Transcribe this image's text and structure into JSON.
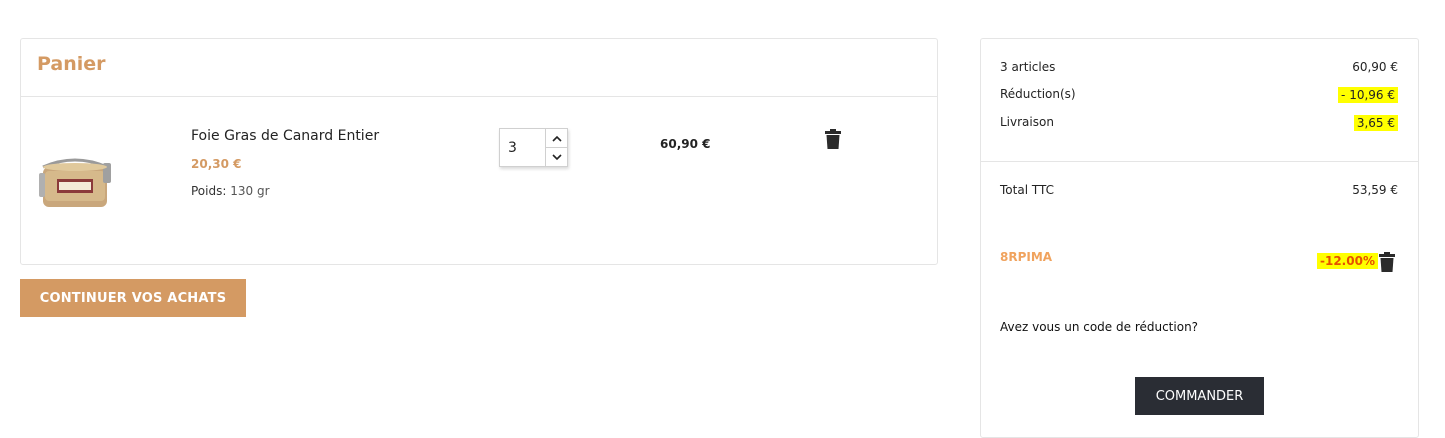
{
  "cart": {
    "title": "Panier",
    "item": {
      "name": "Foie Gras de Canard Entier",
      "unit_price": "20,30 €",
      "weight_label": "Poids:",
      "weight_value": "130 gr",
      "quantity": "3",
      "line_total": "60,90 €",
      "image_icon": "foie-gras-jar-image"
    },
    "continue_label": "CONTINUER VOS ACHATS"
  },
  "summary": {
    "articles_label": "3 articles",
    "articles_value": "60,90 €",
    "reduction_label": "Réduction(s)",
    "reduction_value": "- 10,96 €",
    "shipping_label": "Livraison",
    "shipping_value": "3,65 €",
    "total_label": "Total TTC",
    "total_value": "53,59 €",
    "promo_code": "8RPIMA",
    "promo_percent": "-12.00%",
    "discount_question": "Avez vous un code de réduction?",
    "order_label": "COMMANDER"
  },
  "colors": {
    "accent": "#d49a63",
    "highlight": "#ffff00",
    "dark_button": "#2a2d34"
  }
}
